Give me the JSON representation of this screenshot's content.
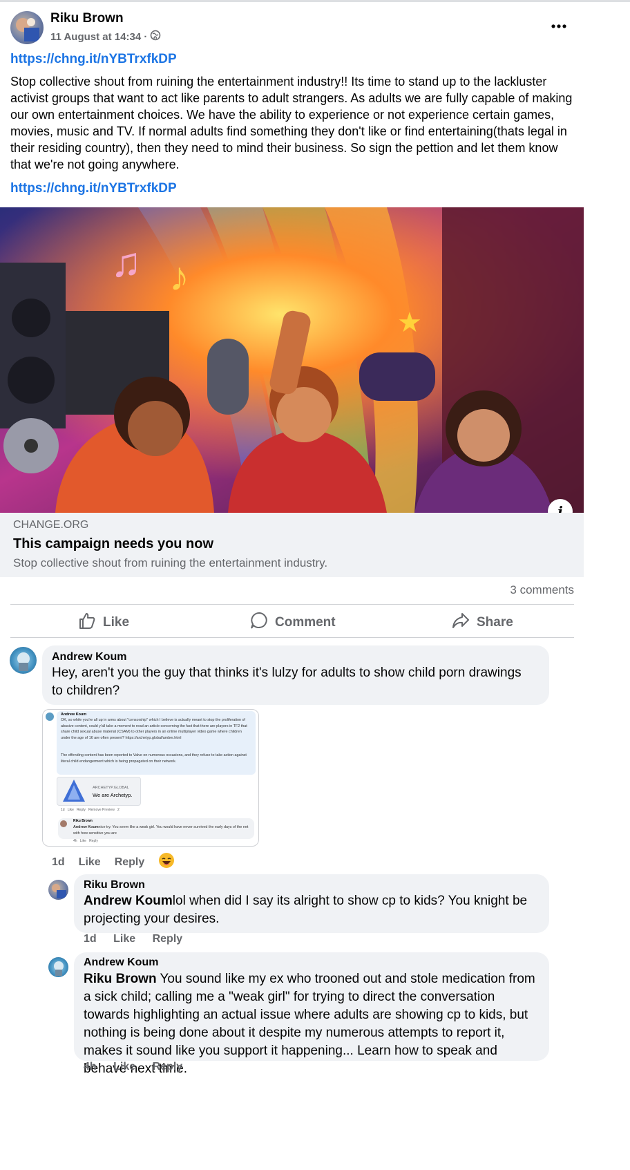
{
  "post": {
    "author": "Riku Brown",
    "timestamp": "11 August at 14:34 ·",
    "privacy_icon": "globe-icon",
    "more_icon": "more-options-icon",
    "link_top": "https://chng.it/nYBTrxfkDP",
    "body": "Stop collective shout from ruining the entertainment industry!!  Its time to stand up to the lackluster activist groups that want to act like parents to adult strangers. As adults we are fully capable of making our own entertainment choices. We have the ability to experience or not experience certain games, movies, music and TV. If normal adults find something they don't like or find entertaining(thats legal in their residing country), then they need to mind their business. So sign the pettion and let them know that we're not going anywhere.",
    "link_bottom": "https://chng.it/nYBTrxfkDP"
  },
  "preview": {
    "domain": "CHANGE.ORG",
    "title": "This campaign needs you now",
    "description": "Stop collective shout from ruining the entertainment industry.",
    "info_icon": "info-icon"
  },
  "stats": {
    "comments": "3 comments"
  },
  "actions": {
    "like": "Like",
    "comment": "Comment",
    "share": "Share"
  },
  "comments": [
    {
      "author": "Andrew Koum",
      "text": "Hey, aren't you the guy that thinks it's lulzy for adults to show child porn drawings to children?",
      "age": "1d",
      "like": "Like",
      "reply": "Reply",
      "reaction": "laughing-emoji"
    },
    {
      "author": "Riku Brown",
      "mention": "Andrew Koum",
      "text": "lol when did I say its alright to show cp to kids? You knight be projecting your desires.",
      "age": "1d",
      "like": "Like",
      "reply": "Reply"
    },
    {
      "author": "Andrew Koum",
      "mention": "Riku Brown",
      "text": " You sound like my ex who trooned out and stole medication from a sick child; calling me a \"weak girl\" for trying to direct the conversation towards highlighting an actual issue where adults are showing cp to kids, but nothing is being done about it despite my numerous attempts to report it, makes it sound like you support it happening... Learn how to speak and behave next time.",
      "age": "4h",
      "like": "Like",
      "reply": "Reply"
    }
  ],
  "screenshot_attachment": {
    "author": "Andrew Koum",
    "para1": "OK, so while you're all up in arms about \"censorship\" which I believe is actually meant to stop the proliferation of abusive content, could y'all take a moment to read an article concerning the fact that there are players in TF2 that share child sexual abuse material (CSAM) to other players in an online multiplayer video game where children under the age of 16 are often present? https://archetyp.global/amber.html",
    "para2": "The offending content has been reported to Valve on numerous occasions, and they refuse to take action against literal child endangerment which is being propagated on their network.",
    "link_domain": "ARCHETYP.GLOBAL",
    "link_title": "We are Archetyp.",
    "meta": "1d   Like   Reply   Remove Preview   2",
    "reply_author": "Riku Brown",
    "reply_mention": "Andrew Koum",
    "reply_text": "nice try. You seem like a weak girl. You would have never survived the early days of the net with how sensitive you are",
    "reply_meta": "4h   Like   Reply"
  }
}
